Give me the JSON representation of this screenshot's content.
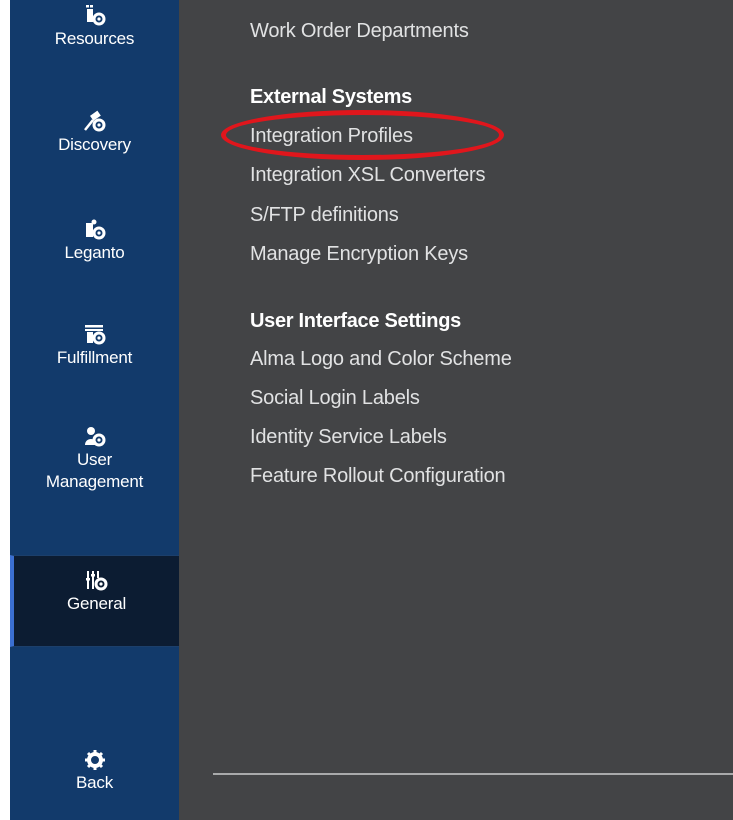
{
  "sidebar": {
    "items": [
      {
        "label": "Resources",
        "icon": "resources-icon"
      },
      {
        "label": "Discovery",
        "icon": "discovery-icon"
      },
      {
        "label": "Leganto",
        "icon": "leganto-icon"
      },
      {
        "label": "Fulfillment",
        "icon": "fulfillment-icon"
      },
      {
        "label_line1": "User",
        "label_line2": "Management",
        "icon": "user-management-icon"
      },
      {
        "label": "General",
        "icon": "general-icon",
        "active": true
      },
      {
        "label": "Back",
        "icon": "back-icon"
      }
    ]
  },
  "menu": {
    "top_link": "Work Order Departments",
    "external_systems": {
      "heading": "External Systems",
      "links": [
        "Integration Profiles",
        "Integration XSL Converters",
        "S/FTP definitions",
        "Manage Encryption Keys"
      ]
    },
    "user_interface_settings": {
      "heading": "User Interface Settings",
      "links": [
        "Alma Logo and Color Scheme",
        "Social Login Labels",
        "Identity Service Labels",
        "Feature Rollout Configuration"
      ]
    }
  },
  "annotation": {
    "highlighted_item": "Integration Profiles",
    "color": "#e0161c"
  },
  "colors": {
    "sidebar": "#123a6b",
    "sidebar_active": "#0c1c32",
    "active_accent": "#3b6fd1",
    "panel": "#434446",
    "link_text": "#e1e2e3"
  }
}
